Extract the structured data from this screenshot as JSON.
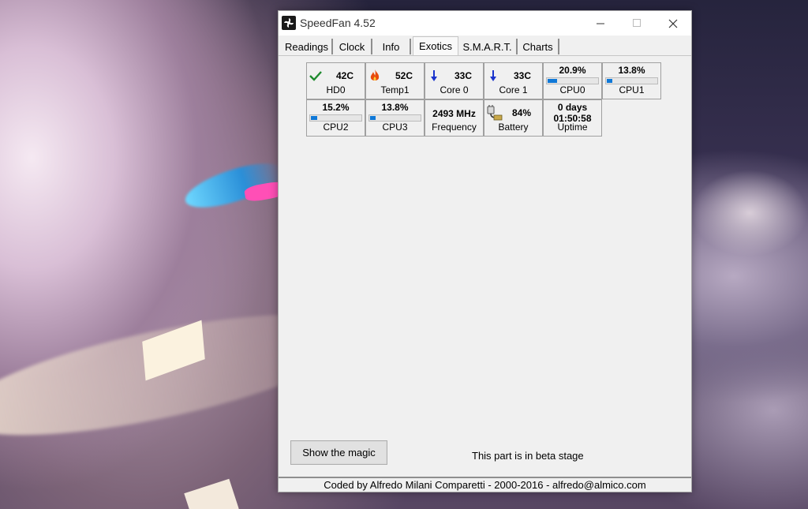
{
  "window": {
    "title": "SpeedFan 4.52",
    "controls": {
      "minimize": "minimize-icon",
      "maximize": "maximize-icon",
      "close": "close-icon"
    }
  },
  "tabs": [
    {
      "label": "Readings",
      "active": false
    },
    {
      "label": "Clock",
      "active": false
    },
    {
      "label": "Info",
      "active": false
    },
    {
      "label": "Exotics",
      "active": true
    },
    {
      "label": "S.M.A.R.T.",
      "active": false
    },
    {
      "label": "Charts",
      "active": false
    }
  ],
  "readings": {
    "hd0": {
      "value": "42C",
      "label": "HD0",
      "icon": "check-icon"
    },
    "temp1": {
      "value": "52C",
      "label": "Temp1",
      "icon": "flame-icon"
    },
    "core0": {
      "value": "33C",
      "label": "Core 0",
      "icon": "arrow-down-icon"
    },
    "core1": {
      "value": "33C",
      "label": "Core 1",
      "icon": "arrow-down-icon"
    },
    "cpu0": {
      "value": "20.9%",
      "label": "CPU0",
      "level": 0.209
    },
    "cpu1": {
      "value": "13.8%",
      "label": "CPU1",
      "level": 0.138
    },
    "cpu2": {
      "value": "15.2%",
      "label": "CPU2",
      "level": 0.152
    },
    "cpu3": {
      "value": "13.8%",
      "label": "CPU3",
      "level": 0.138
    },
    "frequency": {
      "value": "2493 MHz",
      "label": "Frequency"
    },
    "battery": {
      "value": "84%",
      "label": "Battery",
      "icon": "battery-plug-icon"
    },
    "uptime": {
      "days": "0 days",
      "time": "01:50:58",
      "label": "Uptime"
    }
  },
  "colors": {
    "check": "#1e8a2e",
    "flame": "#e84a0c",
    "arrow": "#1a33cc",
    "bar": "#0f78d7"
  },
  "actions": {
    "magic_button": "Show the magic"
  },
  "beta_note": "This part is in beta stage",
  "status": "Coded by Alfredo Milani Comparetti - 2000-2016 - alfredo@almico.com"
}
